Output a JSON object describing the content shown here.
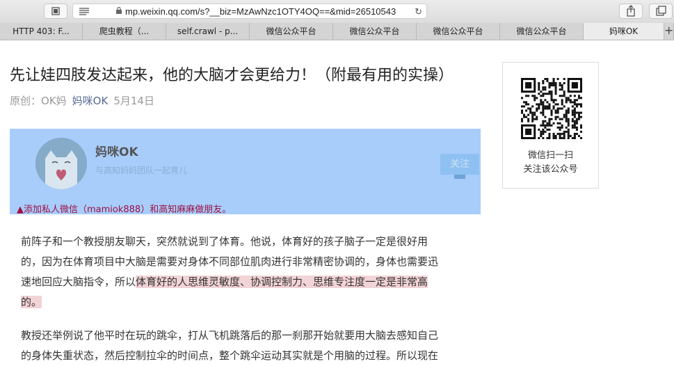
{
  "browser": {
    "url": "mp.weixin.qq.com/s?__biz=MzAwNzc1OTY4OQ==&mid=26510543",
    "tabs": [
      "HTTP 403: F...",
      "爬虫教程（...",
      "self.crawl - p...",
      "微信公众平台",
      "微信公众平台",
      "微信公众平台",
      "微信公众平台",
      "妈咪OK"
    ],
    "active_tab": 7,
    "new_tab": "+"
  },
  "article": {
    "title": "先让娃四肢发达起来，他的大脑才会更给力！（附最有用的实操）",
    "original_label": "原创：",
    "original_author": "OK妈",
    "account": "妈咪OK",
    "date": "5月14日"
  },
  "profile_card": {
    "name": "妈咪OK",
    "description": "与高知妈妈团队一起育儿",
    "follow_label": "关注",
    "note": "▲添加私人微信（mamiok888）和高知麻麻做朋友。"
  },
  "paragraph1": {
    "line1": "前阵子和一个教授朋友聊天，突然就说到了体育。他说，体育好的孩子脑子一定是很好用",
    "line2": "的，因为在体育项目中大脑是需要对身体不同部位肌肉进行非常精密协调的，身体也需要迅",
    "line3_plain": "速地回应大脑指令，所以",
    "line3_highlight": "体育好的人思维灵敏度、协调控制力、思维专注度一定是非常高",
    "line4_highlight": "的。"
  },
  "paragraph2": {
    "line1": "教授还举例说了他平时在玩的跳伞，打从飞机跳落后的那一刹那开始就要用大脑去感知自己",
    "line2": "的身体失重状态，然后控制拉伞的时间点，整个跳伞运动其实就是个用脑的过程。所以现在"
  },
  "qr_panel": {
    "line1": "微信扫一扫",
    "line2": "关注该公众号"
  },
  "colors": {
    "highlight": "#f2d3d6",
    "selection": "#a8cdfb",
    "link": "#576b95",
    "note": "#9e1040"
  }
}
